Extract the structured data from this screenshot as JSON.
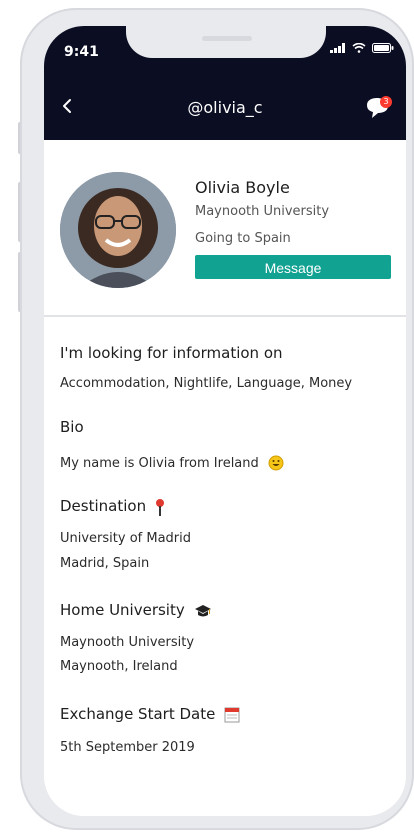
{
  "status_bar": {
    "time": "9:41"
  },
  "header": {
    "title": "@olivia_c",
    "notification_count": "3",
    "colors": {
      "bar": "#0b0d23",
      "badge": "#ff3b30"
    }
  },
  "profile": {
    "name": "Olivia Boyle",
    "university": "Maynooth University",
    "going_to": "Going to Spain",
    "message_button": "Message",
    "accent": "#12a292"
  },
  "sections": {
    "looking_for": {
      "title": "I'm looking for information on",
      "text": "Accommodation, Nightlife, Language, Money"
    },
    "bio": {
      "title": "Bio",
      "text": "My name is Olivia from Ireland"
    },
    "destination": {
      "title": "Destination",
      "line1": "University of Madrid",
      "line2": "Madrid, Spain"
    },
    "home_university": {
      "title": "Home University",
      "line1": "Maynooth University",
      "line2": "Maynooth, Ireland"
    },
    "exchange_start": {
      "title": "Exchange Start Date",
      "text": "5th September 2019"
    }
  },
  "icons": {
    "back": "chevron-left-icon",
    "chat": "chat-bubble-icon",
    "bio_emoji": "smiley-icon",
    "destination": "map-pin-icon",
    "home_university": "graduation-cap-icon",
    "exchange_start": "calendar-icon"
  }
}
